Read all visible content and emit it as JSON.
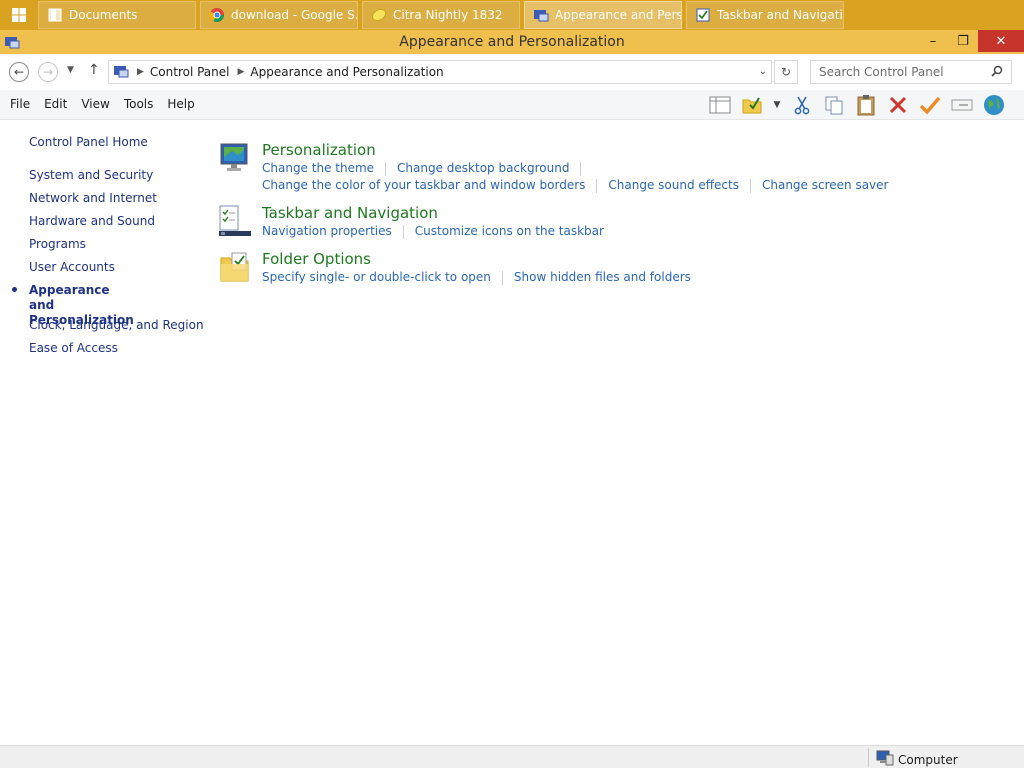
{
  "taskbar": {
    "items": [
      {
        "label": "Documents",
        "active": false
      },
      {
        "label": "download - Google S...",
        "active": false
      },
      {
        "label": "Citra Nightly 1832",
        "active": false
      },
      {
        "label": "Appearance and Pers...",
        "active": true
      },
      {
        "label": "Taskbar and Navigati...",
        "active": false
      }
    ]
  },
  "window": {
    "title": "Appearance and Personalization",
    "controls": {
      "minimize": "–",
      "restore": "❐",
      "close": "✕"
    }
  },
  "address": {
    "crumbs": [
      "Control Panel",
      "Appearance and Personalization"
    ],
    "search_placeholder": "Search Control Panel"
  },
  "menu": [
    "File",
    "Edit",
    "View",
    "Tools",
    "Help"
  ],
  "toolbar_icons": [
    "layout-icon",
    "folder-check-icon",
    "dropdown-arrow-icon",
    "cut-icon",
    "copy-icon",
    "paste-icon",
    "delete-icon",
    "checkmark-icon",
    "rename-icon",
    "globe-icon"
  ],
  "sidebar": {
    "items": [
      {
        "label": "Control Panel Home",
        "current": false
      },
      {
        "label": "System and Security",
        "current": false
      },
      {
        "label": "Network and Internet",
        "current": false
      },
      {
        "label": "Hardware and Sound",
        "current": false
      },
      {
        "label": "Programs",
        "current": false
      },
      {
        "label": "User Accounts",
        "current": false
      },
      {
        "label": "Appearance and Personalization",
        "current": true
      },
      {
        "label": "Clock, Language, and Region",
        "current": false
      },
      {
        "label": "Ease of Access",
        "current": false
      }
    ]
  },
  "sections": [
    {
      "title": "Personalization",
      "icon": "personalization-icon",
      "link_rows": [
        [
          "Change the theme",
          "Change desktop background"
        ],
        [
          "Change the color of your taskbar and window borders",
          "Change sound effects",
          "Change screen saver"
        ]
      ]
    },
    {
      "title": "Taskbar and Navigation",
      "icon": "taskbar-icon",
      "link_rows": [
        [
          "Navigation properties",
          "Customize icons on the taskbar"
        ]
      ]
    },
    {
      "title": "Folder Options",
      "icon": "folder-options-icon",
      "link_rows": [
        [
          "Specify single- or double-click to open",
          "Show hidden files and folders"
        ]
      ]
    }
  ],
  "statusbar": {
    "label": "Computer"
  },
  "colors": {
    "taskbar": "#d9a321",
    "titlebar": "#f0c04e",
    "link": "#2a67b5",
    "section_title": "#1e7a1e",
    "nav_text": "#1e3287"
  }
}
